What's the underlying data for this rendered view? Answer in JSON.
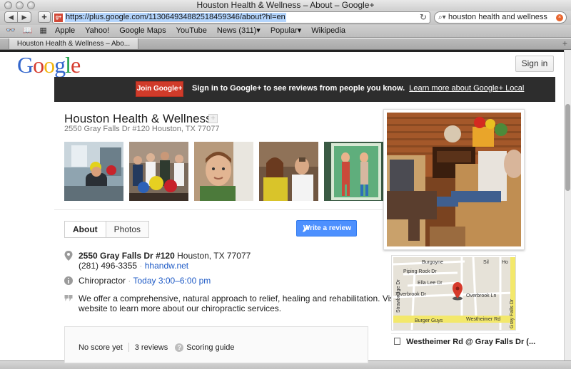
{
  "browser": {
    "window_title": "Houston Health & Wellness – About – Google+",
    "url": "https://plus.google.com/113064934882518459346/about?hl=en",
    "search_query": "houston health and wellness",
    "bookmarks": [
      "Apple",
      "Yahoo!",
      "Google Maps",
      "YouTube",
      "News (311)▾",
      "Popular▾",
      "Wikipedia"
    ],
    "tab_title": "Houston Health & Wellness – Abo..."
  },
  "header": {
    "logo": {
      "G": "G",
      "o1": "o",
      "o2": "o",
      "g": "g",
      "l": "l",
      "e": "e"
    },
    "sign_in": "Sign in"
  },
  "banner": {
    "join_label": "Join Google+",
    "message": "Sign in to Google+ to see reviews from people you know.",
    "learn_more": "Learn more about Google+ Local"
  },
  "business": {
    "name": "Houston Health & Wellness",
    "address": "2550 Gray Falls Dr #120 Houston, TX 77077",
    "street": "2550 Gray Falls Dr #120",
    "city": "Houston, TX 77077",
    "phone": "(281) 496-3355",
    "website": "hhandw.net",
    "category": "Chiropractor",
    "hours": "Today 3:00–6:00 pm",
    "description_line1": "We offer a comprehensive, natural approach to relief, healing and rehabilitation. Visit our",
    "description_line2": "website to learn more about our chiropractic services."
  },
  "tabs": [
    "About",
    "Photos"
  ],
  "write_review": "Write a review",
  "score": {
    "no_score": "No score yet",
    "reviews": "3 reviews",
    "guide": "Scoring guide"
  },
  "map": {
    "streets": [
      "Burgoyne",
      "Piping Rock Dr",
      "Ella Lee Dr",
      "Overbrook Dr",
      "Overbrook Ln",
      "Westheimer Rd",
      "Burger Guys",
      "Sil",
      "Ho",
      "Strawbridge Dr",
      "Gray Falls Dr"
    ],
    "intersection": "Westheimer Rd @ Gray Falls Dr (..."
  },
  "colors": {
    "google_blue": "#3366cc",
    "join_red": "#d03b2a",
    "review_blue": "#4d90fe",
    "banner_dark": "#2d2d2d",
    "link_blue": "#1f5bc6"
  }
}
